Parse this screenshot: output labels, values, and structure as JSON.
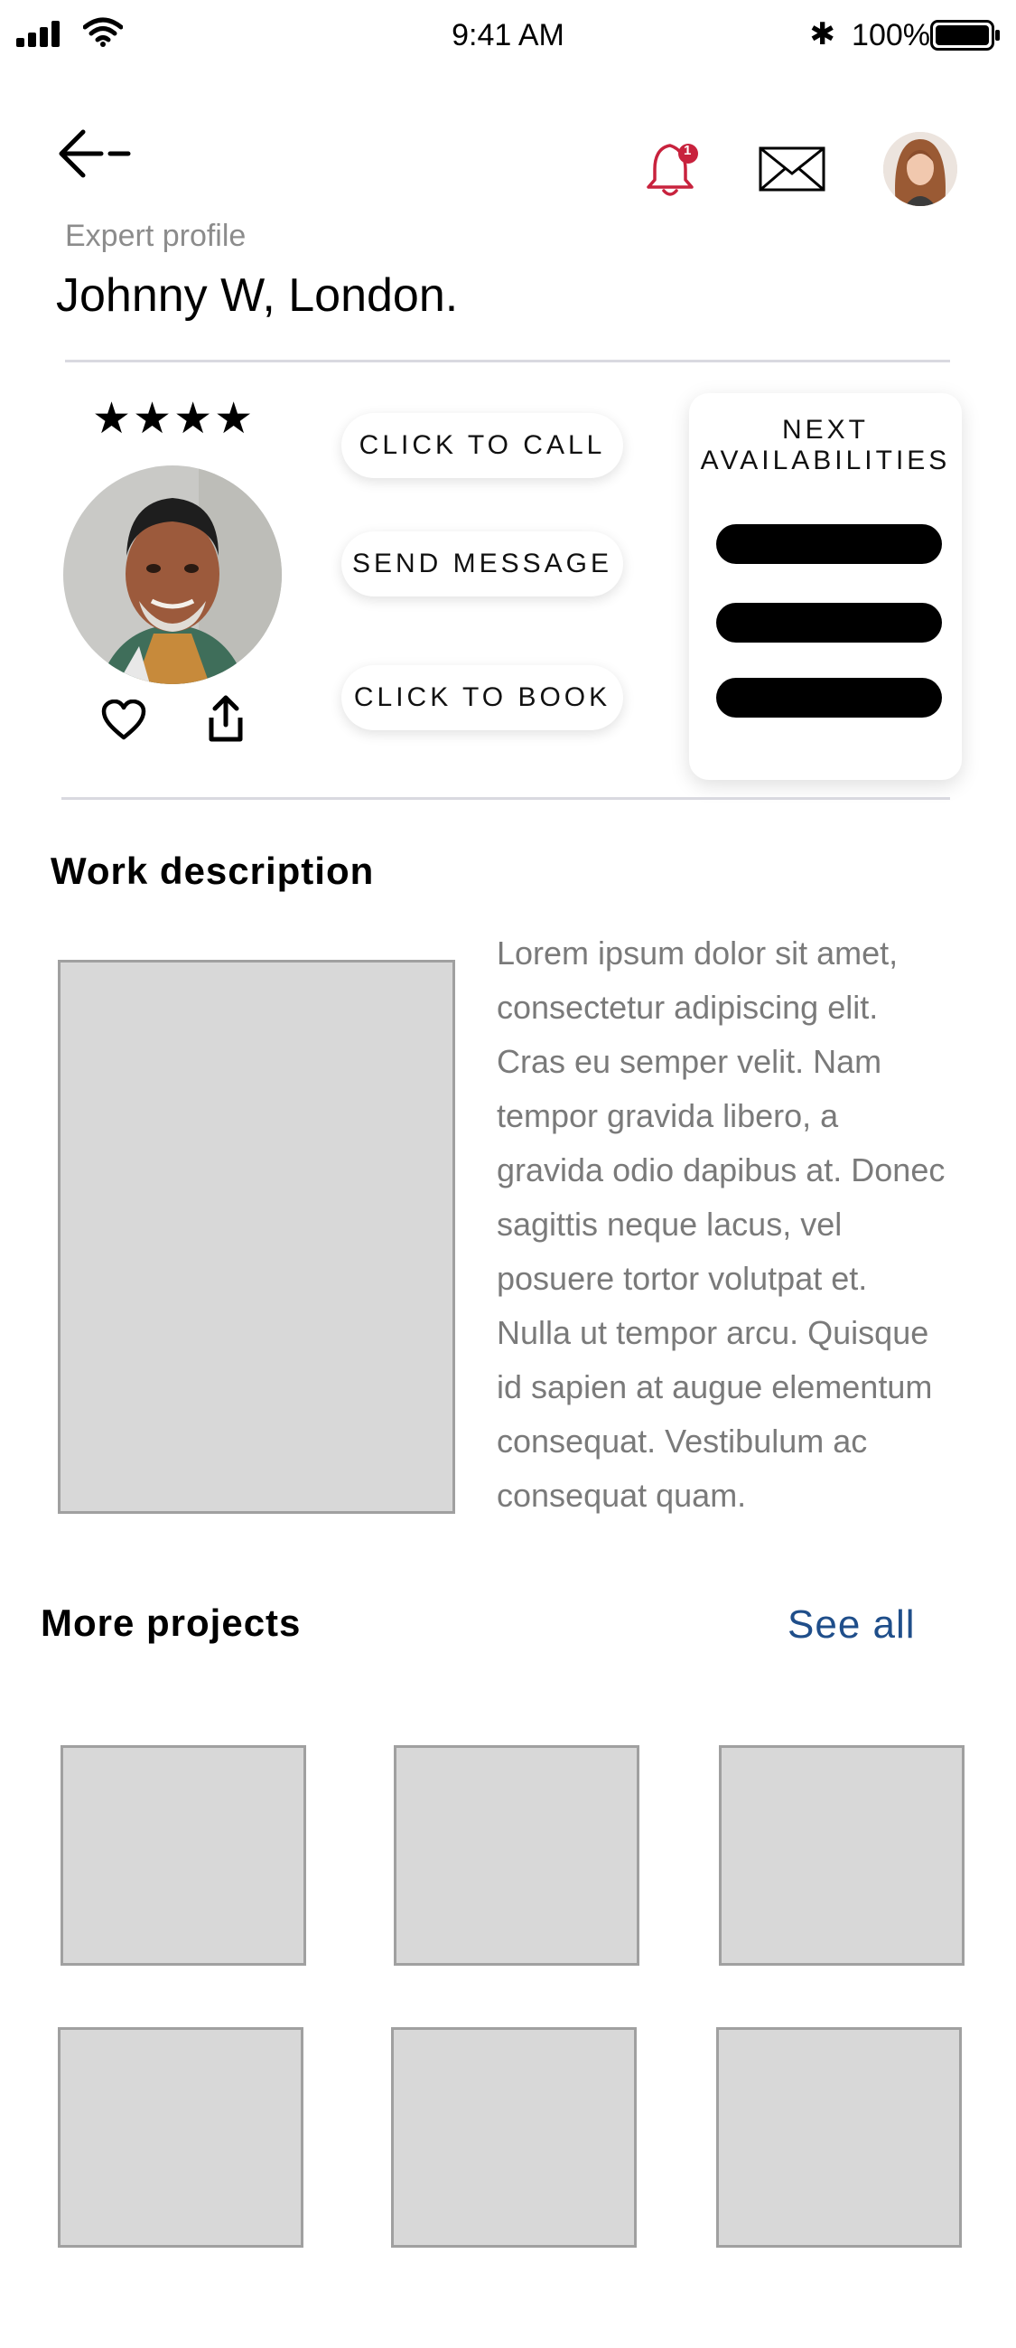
{
  "status_bar": {
    "time": "9:41 AM",
    "battery": "100%"
  },
  "header": {
    "subtitle": "Expert profile",
    "title": "Johnny W, London.",
    "notification_count": "1"
  },
  "profile": {
    "rating": 4,
    "actions": {
      "call": "CLICK TO CALL",
      "message": "SEND MESSAGE",
      "book": "CLICK TO BOOK"
    },
    "availability": {
      "title_line1": "NEXT",
      "title_line2": "AVAILABILITIES"
    }
  },
  "work": {
    "title": "Work description",
    "lines": [
      "Lorem ipsum dolor sit amet,",
      "consectetur adipiscing elit.",
      "Cras eu semper velit. Nam",
      "tempor gravida libero, a",
      "gravida odio dapibus at. Donec",
      "sagittis neque lacus, vel",
      "posuere tortor volutpat et.",
      "Nulla ut tempor arcu. Quisque",
      "id sapien at augue elementum",
      "consequat. Vestibulum ac",
      "consequat quam."
    ]
  },
  "projects": {
    "title": "More projects",
    "see_all": "See all"
  },
  "colors": {
    "accent_red": "#c8223d",
    "link_blue": "#1f4e8a",
    "placeholder": "#d8d8d8"
  }
}
